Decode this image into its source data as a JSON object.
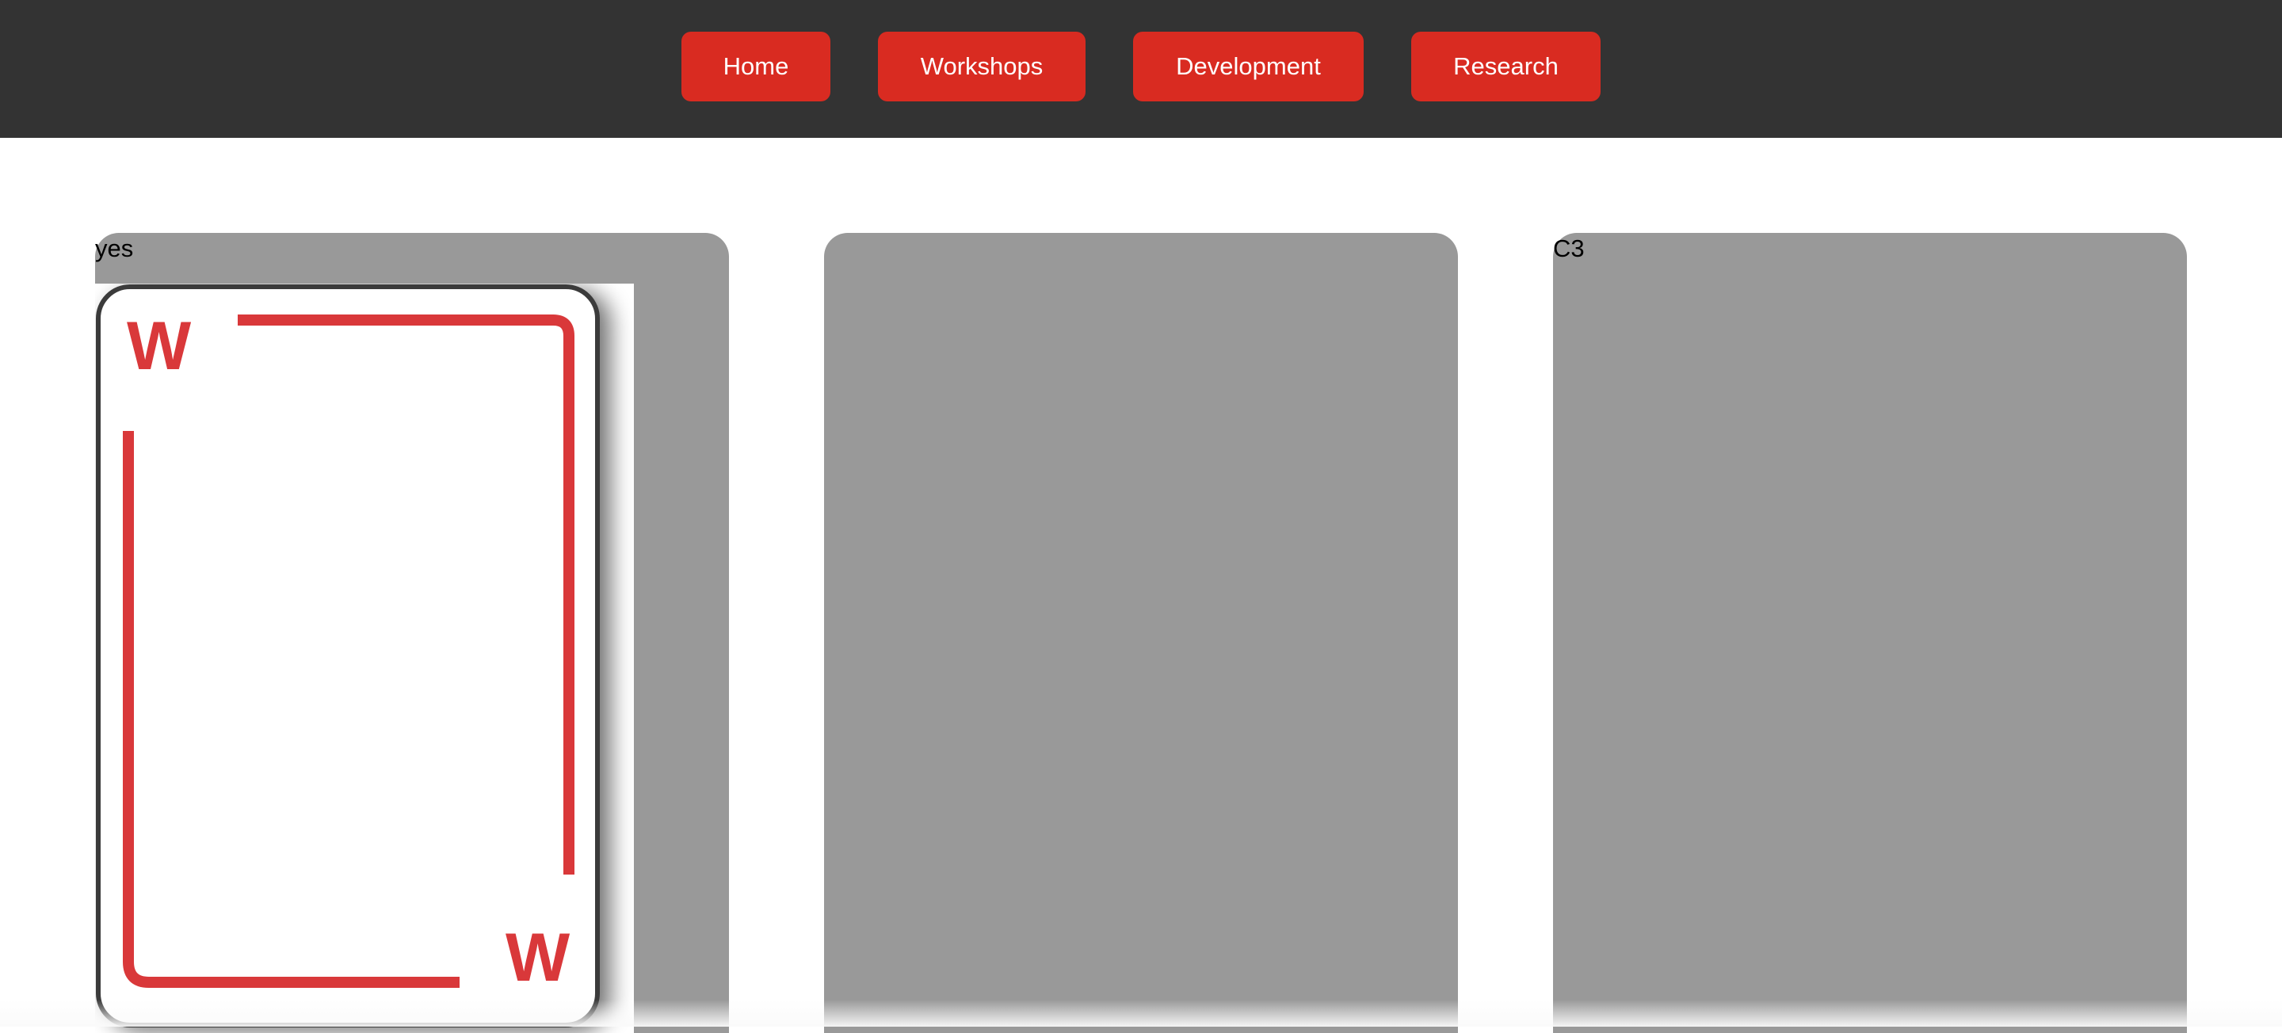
{
  "nav": {
    "home": "Home",
    "workshops": "Workshops",
    "development": "Development",
    "research": "Research"
  },
  "cards": {
    "card1_label": "yes",
    "card3_label": "C3"
  },
  "playing_card": {
    "corner_letter_top": "W",
    "corner_letter_bottom": "W"
  },
  "colors": {
    "topbar": "#333333",
    "nav_button": "#d92b21",
    "card_bg": "#999999",
    "playing_card_accent": "#d9383a"
  }
}
